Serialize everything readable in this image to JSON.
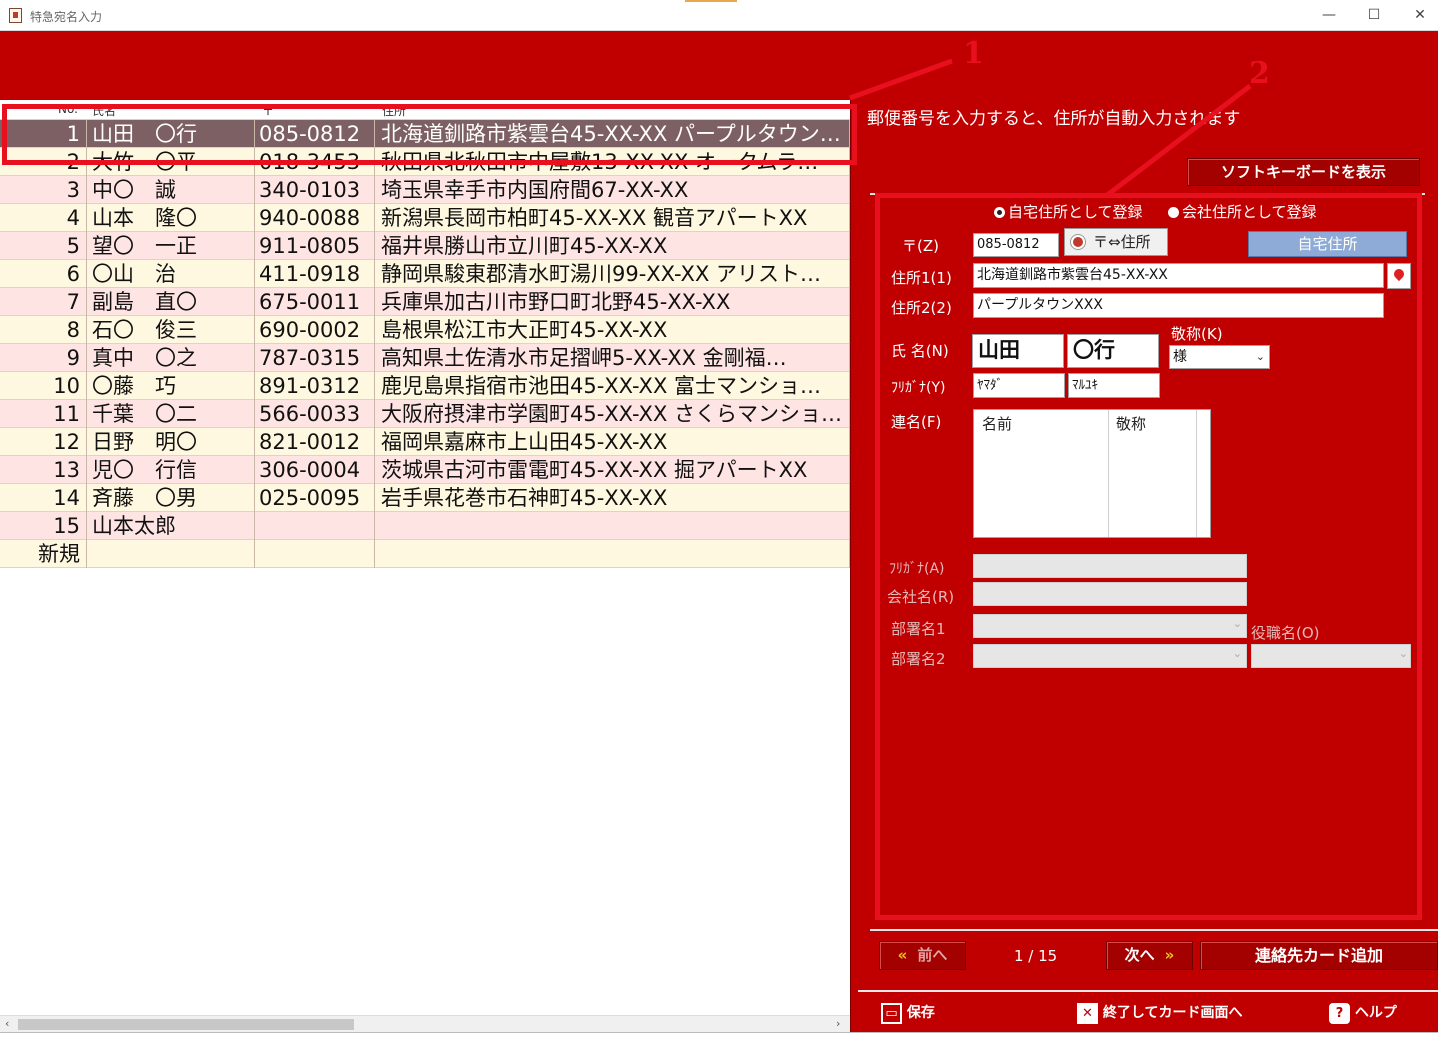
{
  "window": {
    "title": "特急宛名入力",
    "minimize": "—",
    "maximize": "☐",
    "close": "✕"
  },
  "grid": {
    "headers": [
      "No.",
      "氏名",
      "〒",
      "住所"
    ],
    "rows": [
      {
        "no": "1",
        "name": "山田　〇行",
        "zip": "085-0812",
        "addr": "北海道釧路市紫雲台45-XX-XX パープルタウン…",
        "style": "selected"
      },
      {
        "no": "2",
        "name": "大竹　〇平",
        "zip": "018-3453",
        "addr": "秋田県北秋田市中屋敷13-XX-XX オークムラ…",
        "style": "cream"
      },
      {
        "no": "3",
        "name": "中〇　誠",
        "zip": "340-0103",
        "addr": "埼玉県幸手市内国府間67-XX-XX",
        "style": "pink"
      },
      {
        "no": "4",
        "name": "山本　隆〇",
        "zip": "940-0088",
        "addr": "新潟県長岡市柏町45-XX-XX 観音アパートXX",
        "style": "cream"
      },
      {
        "no": "5",
        "name": "望〇　一正",
        "zip": "911-0805",
        "addr": "福井県勝山市立川町45-XX-XX",
        "style": "pink"
      },
      {
        "no": "6",
        "name": "〇山　治",
        "zip": "411-0918",
        "addr": "静岡県駿東郡清水町湯川99-XX-XX アリスト…",
        "style": "cream"
      },
      {
        "no": "7",
        "name": "副島　直〇",
        "zip": "675-0011",
        "addr": "兵庫県加古川市野口町北野45-XX-XX",
        "style": "pink"
      },
      {
        "no": "8",
        "name": "石〇　俊三",
        "zip": "690-0002",
        "addr": "島根県松江市大正町45-XX-XX",
        "style": "cream"
      },
      {
        "no": "9",
        "name": "真中　〇之",
        "zip": "787-0315",
        "addr": "高知県土佐清水市足摺岬5-XX-XX 金剛福…",
        "style": "pink"
      },
      {
        "no": "10",
        "name": "〇藤　巧",
        "zip": "891-0312",
        "addr": "鹿児島県指宿市池田45-XX-XX 富士マンショ…",
        "style": "cream"
      },
      {
        "no": "11",
        "name": "千葉　〇二",
        "zip": "566-0033",
        "addr": "大阪府摂津市学園町45-XX-XX さくらマンショ…",
        "style": "pink"
      },
      {
        "no": "12",
        "name": "日野　明〇",
        "zip": "821-0012",
        "addr": "福岡県嘉麻市上山田45-XX-XX",
        "style": "cream"
      },
      {
        "no": "13",
        "name": "児〇　行信",
        "zip": "306-0004",
        "addr": "茨城県古河市雷電町45-XX-XX 掘アパートXX",
        "style": "pink"
      },
      {
        "no": "14",
        "name": "斉藤　〇男",
        "zip": "025-0095",
        "addr": "岩手県花巻市石神町45-XX-XX",
        "style": "cream"
      },
      {
        "no": "15",
        "name": "山本太郎",
        "zip": "",
        "addr": "",
        "style": "pink"
      },
      {
        "no": "新規",
        "name": "",
        "zip": "",
        "addr": "",
        "style": "cream"
      }
    ]
  },
  "panel": {
    "hint": "郵便番号を入力すると、住所が自動入力されます",
    "soft_keyboard": "ソフトキーボードを表示",
    "radio_home": "自宅住所として登録",
    "radio_company": "会社住所として登録",
    "zip_label": "〒(Z)",
    "zip_value": "085-0812",
    "zip_to_addr": "〒⇔住所",
    "addr_type": "自宅住所",
    "addr1_label": "住所1(1)",
    "addr1_value": "北海道釧路市紫雲台45-XX-XX",
    "addr2_label": "住所2(2)",
    "addr2_value": "パープルタウンXXX",
    "name_label": "氏 名(N)",
    "last_name": "山田",
    "first_name": "〇行",
    "honorific_label": "敬称(K)",
    "honorific_value": "様",
    "kana_label": "ﾌﾘｶﾞﾅ(Y)",
    "last_kana": "ﾔﾏﾀﾞ",
    "first_kana": "ﾏﾙﾕｷ",
    "joint_label": "連名(F)",
    "joint_col_name": "名前",
    "joint_col_honorific": "敬称",
    "company_kana_label": "ﾌﾘｶﾞﾅ(A)",
    "company_label": "会社名(R)",
    "dept1_label": "部署名1",
    "dept2_label": "部署名2",
    "position_label": "役職名(O)",
    "prev": "前へ",
    "page_indicator": "1 / 15",
    "next": "次へ",
    "add_card": "連絡先カード追加",
    "save": "保存",
    "exit_to_card": "終了してカード画面へ",
    "help": "ヘルプ"
  },
  "annotations": {
    "label_1": "1",
    "label_2": "2"
  },
  "colors": {
    "accent_red": "#c00000",
    "highlight_red": "#e8101e",
    "selected_row": "#7d6063",
    "row_pink": "#ffe4e4",
    "row_cream": "#fff8e0"
  }
}
